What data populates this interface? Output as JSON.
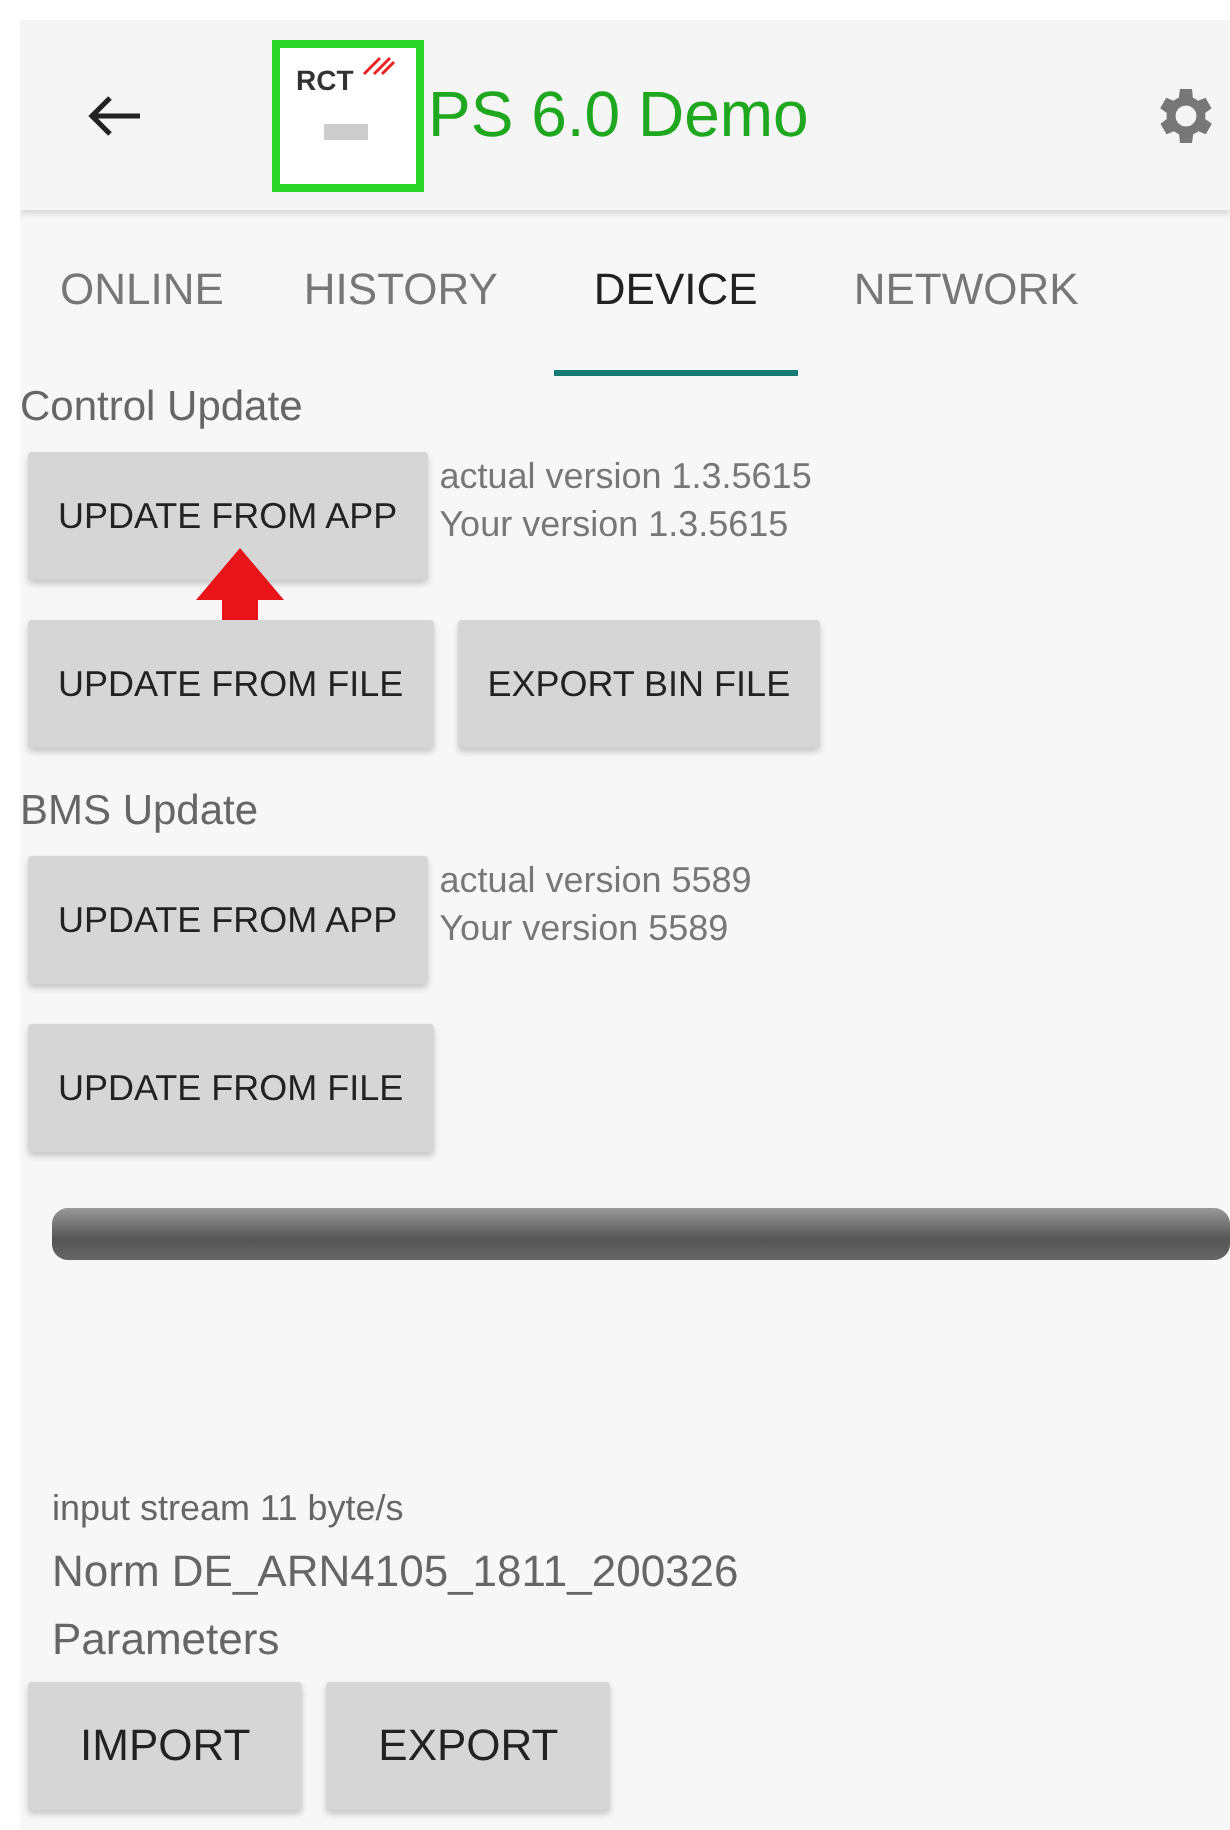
{
  "toolbar": {
    "title": "PS 6.0 Demo",
    "logo_text": "RCT"
  },
  "tabs": [
    {
      "label": "ONLINE",
      "selected": false
    },
    {
      "label": "HISTORY",
      "selected": false
    },
    {
      "label": "DEVICE",
      "selected": true
    },
    {
      "label": "NETWORK",
      "selected": false
    }
  ],
  "sections": [
    {
      "title": "Control Update",
      "rows": [
        {
          "buttons": [
            "UPDATE FROM APP"
          ],
          "versions": [
            "actual version 1.3.5615",
            "Your version 1.3.5615"
          ]
        },
        {
          "buttons": [
            "UPDATE FROM FILE",
            "EXPORT BIN FILE"
          ]
        }
      ]
    },
    {
      "title": "BMS Update",
      "rows": [
        {
          "buttons": [
            "UPDATE FROM APP"
          ],
          "versions": [
            "actual version 5589",
            "Your version 5589"
          ]
        },
        {
          "buttons": [
            "UPDATE FROM FILE"
          ]
        }
      ]
    }
  ],
  "input_stream": "input stream 11 byte/s",
  "norm": "Norm DE_ARN4105_1811_200326",
  "parameters": {
    "title": "Parameters",
    "buttons": [
      "IMPORT",
      "EXPORT"
    ]
  }
}
